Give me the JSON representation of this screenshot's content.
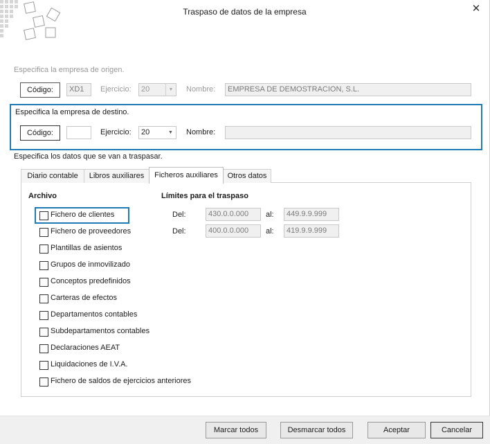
{
  "window": {
    "title": "Traspaso de datos de la empresa",
    "close_glyph": "✕"
  },
  "origin": {
    "heading": "Especifica la empresa de origen.",
    "codigo_button": "Código:",
    "codigo_value": "XD1",
    "ejercicio_label": "Ejercicio:",
    "ejercicio_value": "20",
    "nombre_label": "Nombre:",
    "nombre_value": "EMPRESA DE DEMOSTRACION, S.L."
  },
  "destination": {
    "heading": "Especifica la empresa de destino.",
    "codigo_button": "Código:",
    "codigo_value": "",
    "ejercicio_label": "Ejercicio:",
    "ejercicio_value": "20",
    "nombre_label": "Nombre:",
    "nombre_value": ""
  },
  "data_heading": "Especifica los datos que se van a traspasar.",
  "tabs": [
    {
      "label": "Diario contable",
      "selected": false
    },
    {
      "label": "Libros auxiliares",
      "selected": false
    },
    {
      "label": "Ficheros auxiliares",
      "selected": true
    },
    {
      "label": "Otros datos",
      "selected": false
    }
  ],
  "panel": {
    "archivo_label": "Archivo",
    "limites_label": "Límites para el traspaso",
    "checkboxes": [
      {
        "label": "Fichero de clientes",
        "checked": false
      },
      {
        "label": "Fichero de proveedores",
        "checked": false
      },
      {
        "label": "Plantillas de asientos",
        "checked": false
      },
      {
        "label": "Grupos de inmovilizado",
        "checked": false
      },
      {
        "label": "Conceptos predefinidos",
        "checked": false
      },
      {
        "label": "Carteras de efectos",
        "checked": false
      },
      {
        "label": "Departamentos contables",
        "checked": false
      },
      {
        "label": "Subdepartamentos contables",
        "checked": false
      },
      {
        "label": "Declaraciones AEAT",
        "checked": false
      },
      {
        "label": "Liquidaciones de I.V.A.",
        "checked": false
      },
      {
        "label": "Fichero de saldos de ejercicios anteriores",
        "checked": false
      }
    ],
    "limits": [
      {
        "del_label": "Del:",
        "del_value": "430.0.0.000",
        "al_label": "al:",
        "al_value": "449.9.9.999"
      },
      {
        "del_label": "Del:",
        "del_value": "400.0.0.000",
        "al_label": "al:",
        "al_value": "419.9.9.999"
      }
    ]
  },
  "buttons": {
    "marcar_todos": "Marcar todos",
    "desmarcar_todos": "Desmarcar todos",
    "aceptar": "Aceptar",
    "cancelar": "Cancelar"
  },
  "colors": {
    "highlight": "#1f7ab3",
    "disabled_text": "#9a9a9a"
  }
}
